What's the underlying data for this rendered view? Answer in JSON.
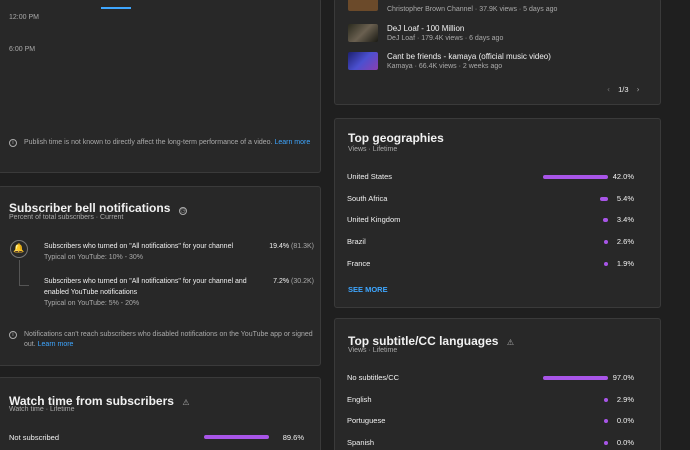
{
  "heatmap": {
    "times": [
      "12:00 PM",
      "6:00 PM"
    ],
    "note": "Publish time is not known to directly affect the long-term performance of a video.",
    "learn_more": "Learn more"
  },
  "bell": {
    "title": "Subscriber bell notifications",
    "subtitle": "Percent of total subscribers · Current",
    "items": [
      {
        "text": "Subscribers who turned on \"All notifications\" for your channel",
        "typical": "Typical on YouTube: 10% - 30%",
        "percent": "19.4%",
        "count": "(81.3K)"
      },
      {
        "text": "Subscribers who turned on \"All notifications\" for your channel and enabled YouTube notifications",
        "typical": "Typical on YouTube: 5% - 20%",
        "percent": "7.2%",
        "count": "(30.2K)"
      }
    ],
    "note": "Notifications can't reach subscribers who disabled notifications on the YouTube app or signed out.",
    "learn_more": "Learn more"
  },
  "watch": {
    "title": "Watch time from subscribers",
    "subtitle": "Watch time · Lifetime",
    "rows": [
      {
        "label": "Not subscribed",
        "value": "89.6%",
        "fraction": 0.896
      }
    ]
  },
  "videos": {
    "items": [
      {
        "title": "",
        "meta": "Christopher Brown Channel · 37.9K views · 5 days ago",
        "thumb_color": "#6b4a2a"
      },
      {
        "title": "DeJ Loaf - 100 Million",
        "meta": "DeJ Loaf · 179.4K views · 6 days ago",
        "thumb_color": "#3a3a2a"
      },
      {
        "title": "Cant be friends - kamaya (official music video)",
        "meta": "Kamaya · 66.4K views · 2 weeks ago",
        "thumb_color": "#3b3fb0"
      }
    ],
    "pager": "1/3"
  },
  "geo": {
    "title": "Top geographies",
    "subtitle": "Views · Lifetime",
    "rows": [
      {
        "label": "United States",
        "value": "42.0%",
        "fraction": 0.42
      },
      {
        "label": "South Africa",
        "value": "5.4%",
        "fraction": 0.054
      },
      {
        "label": "United Kingdom",
        "value": "3.4%",
        "fraction": 0.034
      },
      {
        "label": "Brazil",
        "value": "2.6%",
        "fraction": 0.026
      },
      {
        "label": "France",
        "value": "1.9%",
        "fraction": 0.019
      }
    ],
    "see_more": "SEE MORE"
  },
  "subs": {
    "title": "Top subtitle/CC languages",
    "subtitle": "Views · Lifetime",
    "rows": [
      {
        "label": "No subtitles/CC",
        "value": "97.0%",
        "fraction": 0.97
      },
      {
        "label": "English",
        "value": "2.9%",
        "fraction": 0.029
      },
      {
        "label": "Portuguese",
        "value": "0.0%",
        "fraction": 0.0
      },
      {
        "label": "Spanish",
        "value": "0.0%",
        "fraction": 0.0
      }
    ]
  },
  "colors": {
    "accent": "#a855e8",
    "link": "#3ea6ff",
    "tab_indicator": "#3ea6ff"
  }
}
